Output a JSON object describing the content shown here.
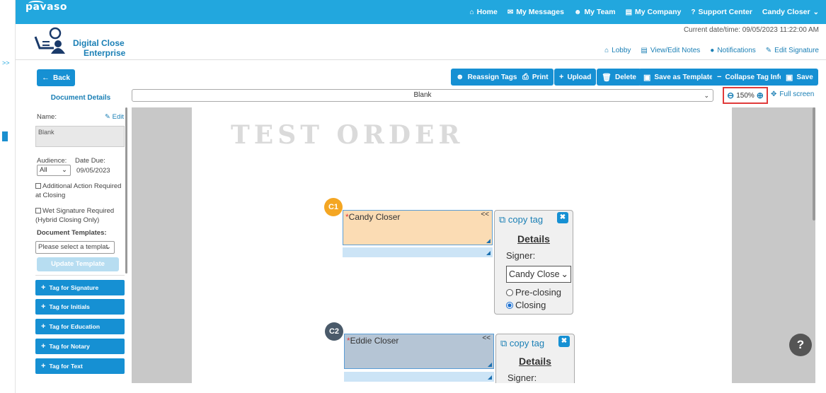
{
  "topbar": {
    "logo": "pavaso",
    "nav": [
      {
        "icon": "home-icon",
        "glyph": "⌂",
        "label": "Home"
      },
      {
        "icon": "envelope-icon",
        "glyph": "✉",
        "label": "My Messages"
      },
      {
        "icon": "team-icon",
        "glyph": "☻",
        "label": "My Team"
      },
      {
        "icon": "building-icon",
        "glyph": "▤",
        "label": "My Company"
      },
      {
        "icon": "question-circle-icon",
        "glyph": "?",
        "label": "Support Center"
      },
      {
        "icon": "chevron-down-icon",
        "glyph": "⌄",
        "label": "Candy Closer"
      }
    ]
  },
  "brand": {
    "line1": "Digital Close",
    "line2": "Enterprise"
  },
  "header": {
    "datetime": "Current date/time: 09/05/2023 11:22:00 AM",
    "subnav": [
      {
        "icon": "lobby-icon",
        "glyph": "⌂",
        "label": "Lobby"
      },
      {
        "icon": "document-icon",
        "glyph": "▤",
        "label": "View/Edit Notes"
      },
      {
        "icon": "chat-icon",
        "glyph": "●",
        "label": "Notifications"
      },
      {
        "icon": "pen-icon",
        "glyph": "✎",
        "label": "Edit Signature"
      }
    ],
    "expand": ">>"
  },
  "toolbar": {
    "back": "Back",
    "reassign": "Reassign Tags",
    "print": "Print",
    "upload": "Upload",
    "delete": "Delete",
    "save_template": "Save as Template",
    "collapse": "Collapse Tag Info",
    "save": "Save"
  },
  "details": {
    "title": "Document Details",
    "name_label": "Name:",
    "edit": "Edit",
    "name_value": "Blank",
    "audience_label": "Audience:",
    "date_due_label": "Date Due:",
    "audience_value": "All",
    "date_due": "09/05/2023",
    "additional_action": "Additional Action Required at Closing",
    "wet_signature": "Wet Signature Required (Hybrid Closing Only)",
    "templates_label": "Document Templates:",
    "template_placeholder": "Please select a templat",
    "update_template": "Update Template",
    "tag_buttons": [
      "Tag for Signature",
      "Tag for Initials",
      "Tag for Education",
      "Tag for Notary",
      "Tag for Text"
    ]
  },
  "doc_select": {
    "value": "Blank"
  },
  "zoom": {
    "level": "150%",
    "fullscreen": "Full screen"
  },
  "page": {
    "watermark": "TEST ORDER"
  },
  "tags": [
    {
      "badge": "C1",
      "badge_color": "#f4a623",
      "name": "Candy Closer",
      "fill": "#fbdcb4",
      "panel": {
        "copy": "copy tag",
        "details": "Details",
        "signer_label": "Signer:",
        "signer": "Candy Close",
        "pre": "Pre-closing",
        "closing": "Closing",
        "selected": "closing"
      }
    },
    {
      "badge": "C2",
      "badge_color": "#4a5a6a",
      "name": "Eddie Closer",
      "fill": "#b5c5d5",
      "panel": {
        "copy": "copy tag",
        "details": "Details",
        "signer_label": "Signer:"
      }
    }
  ],
  "help": "?"
}
